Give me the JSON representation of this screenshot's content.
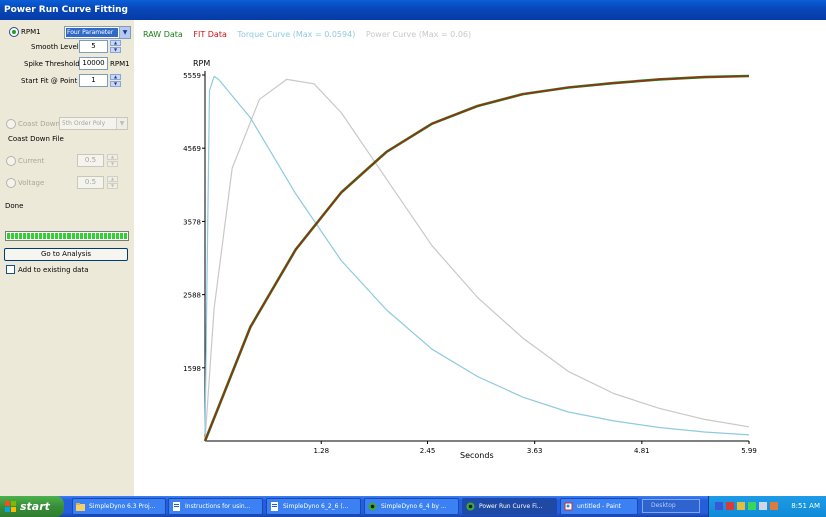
{
  "window": {
    "title": "Power Run Curve Fitting"
  },
  "panel": {
    "rpm_label": "RPM1",
    "fit_method": "Four Parameter",
    "smooth_label": "Smooth Level",
    "smooth_value": "5",
    "spike_label": "Spike Threshold",
    "spike_value": "10000",
    "spike_unit": "RPM1",
    "startfit_label": "Start Fit @ Point",
    "startfit_value": "1",
    "coastdown_label": "Coast Down",
    "coastdown_fit": "5th Order Poly",
    "coastdown_file_label": "Coast Down File",
    "current_label": "Current",
    "current_value": "0.5",
    "voltage_label": "Voltage",
    "voltage_value": "0.5",
    "status": "Done",
    "progress": 1.0,
    "analysis_button": "Go to Analysis",
    "add_existing_label": "Add to existing data"
  },
  "chart_data": {
    "type": "line",
    "legend": [
      {
        "label": "RAW Data",
        "color": "#1a7f1a"
      },
      {
        "label": "FIT Data",
        "color": "#cc1111"
      },
      {
        "label": "Torque Curve (Max = 0.0594)",
        "color": "#8ecae0"
      },
      {
        "label": "Power Curve (Max = 0.06)",
        "color": "#c8c8c8"
      }
    ],
    "ylabel": "RPM",
    "xlabel": "Seconds",
    "ylim": [
      608,
      5559
    ],
    "xlim": [
      0,
      5.99
    ],
    "yticks": [
      "1598",
      "2588",
      "3578",
      "4569",
      "5559"
    ],
    "xticks": [
      "1.28",
      "2.45",
      "3.63",
      "4.81",
      "5.99"
    ],
    "series": [
      {
        "name": "RAW Data",
        "color": "#1a7f1a",
        "x": [
          0.0,
          0.5,
          1.0,
          1.5,
          2.0,
          2.5,
          3.0,
          3.5,
          4.0,
          4.5,
          5.0,
          5.5,
          5.99
        ],
        "y": [
          608,
          2150,
          3200,
          3970,
          4520,
          4900,
          5140,
          5300,
          5390,
          5450,
          5500,
          5530,
          5545
        ]
      },
      {
        "name": "FIT Data",
        "color": "#cc1111",
        "x": [
          0.0,
          0.5,
          1.0,
          1.5,
          2.0,
          2.5,
          3.0,
          3.5,
          4.0,
          4.5,
          5.0,
          5.5,
          5.99
        ],
        "y": [
          608,
          2150,
          3200,
          3970,
          4520,
          4900,
          5140,
          5300,
          5390,
          5450,
          5500,
          5530,
          5545
        ]
      },
      {
        "name": "Torque Curve (Max = 0.0594)",
        "color": "#8ecae0",
        "x": [
          0.0,
          0.05,
          0.1,
          0.15,
          0.5,
          1.0,
          1.5,
          2.0,
          2.5,
          3.0,
          3.5,
          4.0,
          4.5,
          5.0,
          5.5,
          5.99
        ],
        "y": [
          700,
          5350,
          5540,
          5500,
          4980,
          3950,
          3050,
          2380,
          1850,
          1480,
          1200,
          1000,
          880,
          790,
          730,
          690
        ]
      },
      {
        "name": "Power Curve (Max = 0.06)",
        "color": "#c8c8c8",
        "x": [
          0.0,
          0.1,
          0.3,
          0.6,
          0.9,
          1.2,
          1.5,
          2.0,
          2.5,
          3.0,
          3.5,
          4.0,
          4.5,
          5.0,
          5.5,
          5.99
        ],
        "y": [
          608,
          2400,
          4300,
          5230,
          5500,
          5440,
          5050,
          4150,
          3250,
          2550,
          2000,
          1550,
          1250,
          1050,
          900,
          800
        ]
      }
    ]
  },
  "taskbar": {
    "start_label": "start",
    "tasks": [
      {
        "label": "SimpleDyno 6.3 Proj...",
        "active": false
      },
      {
        "label": "Instructions for usin...",
        "active": false
      },
      {
        "label": "SimpleDyno 6_2_6 (...",
        "active": false
      },
      {
        "label": "SimpleDyno 6_4 by ...",
        "active": false
      },
      {
        "label": "Power Run Curve Fi...",
        "active": true
      },
      {
        "label": "untitled - Paint",
        "active": false
      }
    ],
    "desktop_label": "Desktop",
    "clock": "8:51 AM"
  }
}
